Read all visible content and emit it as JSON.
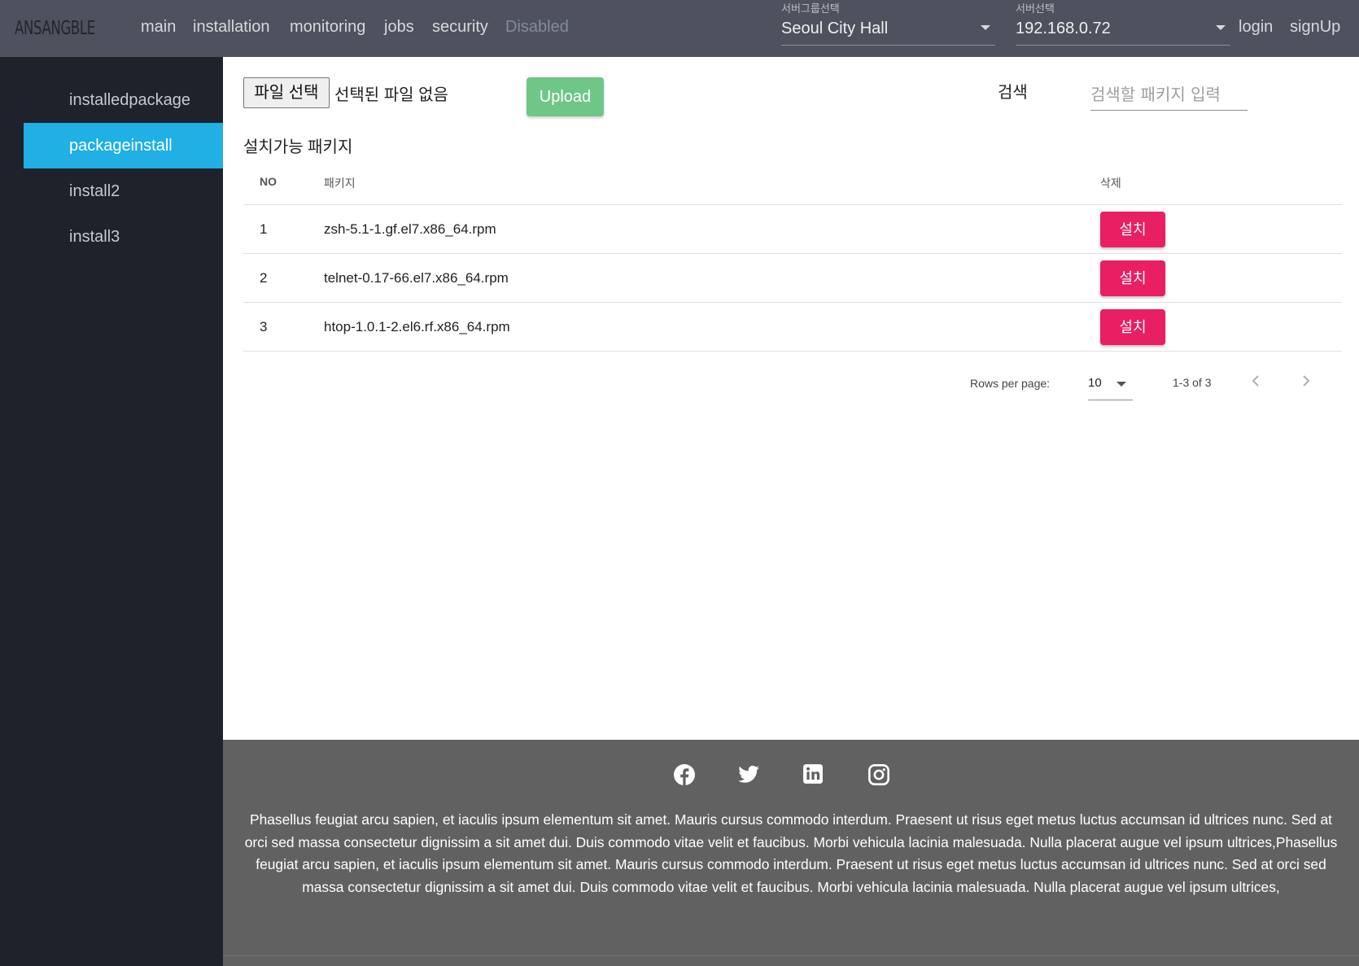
{
  "brand": "ANSANGBLE",
  "nav": {
    "links": [
      "main",
      "installation",
      "monitoring",
      "jobs",
      "security"
    ],
    "disabled": "Disabled",
    "login": "login",
    "signup": "signUp"
  },
  "server_group": {
    "label": "서버그룹선택",
    "value": "Seoul City Hall"
  },
  "server": {
    "label": "서버선택",
    "value": "192.168.0.72"
  },
  "sidebar": {
    "items": [
      {
        "label": "installedpackage"
      },
      {
        "label": "packageinstall"
      },
      {
        "label": "install2"
      },
      {
        "label": "install3"
      }
    ],
    "active": "packageinstall"
  },
  "upload": {
    "file_button": "파일 선택",
    "file_status": "선택된 파일 없음",
    "upload_label": "Upload"
  },
  "search": {
    "label": "검색",
    "placeholder": "검색할 패키지 입력"
  },
  "section_title": "설치가능 패키지",
  "table": {
    "headers": {
      "no": "NO",
      "package": "패키지",
      "action": "삭제"
    },
    "rows": [
      {
        "no": "1",
        "package": "zsh-5.1-1.gf.el7.x86_64.rpm",
        "action": "설치"
      },
      {
        "no": "2",
        "package": "telnet-0.17-66.el7.x86_64.rpm",
        "action": "설치"
      },
      {
        "no": "3",
        "package": "htop-1.0.1-2.el6.rf.x86_64.rpm",
        "action": "설치"
      }
    ]
  },
  "pagination": {
    "rows_per_page_label": "Rows per page:",
    "rows_per_page": "10",
    "range": "1-3 of 3"
  },
  "footer": {
    "social_icons": [
      "facebook-icon",
      "twitter-icon",
      "linkedin-icon",
      "instagram-icon"
    ],
    "text": "Phasellus feugiat arcu sapien, et iaculis ipsum elementum sit amet. Mauris cursus commodo interdum. Praesent ut risus eget metus luctus accumsan id ultrices nunc. Sed at orci sed massa consectetur dignissim a sit amet dui. Duis commodo vitae velit et faucibus. Morbi vehicula lacinia malesuada. Nulla placerat augue vel ipsum ultrices,Phasellus feugiat arcu sapien, et iaculis ipsum elementum sit amet. Mauris cursus commodo interdum. Praesent ut risus eget metus luctus accumsan id ultrices nunc. Sed at orci sed massa consectetur dignissim a sit amet dui. Duis commodo vitae velit et faucibus. Morbi vehicula lacinia malesuada. Nulla placerat augue vel ipsum ultrices,"
  },
  "colors": {
    "topbar": "#4d525e",
    "sidebar": "#1e222b",
    "sidebar_active": "#20b0e3",
    "upload_button": "#6fc687",
    "install_button": "#e91e63",
    "footer": "#616161"
  }
}
